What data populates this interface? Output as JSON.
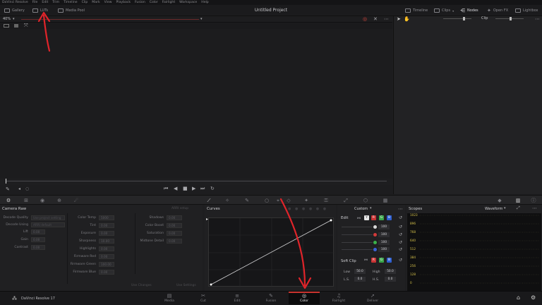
{
  "menu": [
    "DaVinci Resolve",
    "File",
    "Edit",
    "Trim",
    "Timeline",
    "Clip",
    "Mark",
    "View",
    "Playback",
    "Fusion",
    "Color",
    "Fairlight",
    "Workspace",
    "Help"
  ],
  "toolbar": {
    "gallery": "Gallery",
    "luts": "LUTs",
    "media_pool": "Media Pool",
    "project_title": "Untitled Project",
    "timeline": "Timeline",
    "clips": "Clips",
    "nodes": "Nodes",
    "open_fx": "Open FX",
    "lightbox": "Lightbox"
  },
  "viewer": {
    "zoom": "40%",
    "clip_label": "Clip"
  },
  "camera_raw": {
    "title": "Camera Raw",
    "decode_quality_label": "Decode Quality",
    "decode_quality_value": "Use project setting",
    "decode_using_label": "Decode Using",
    "decode_using_value": "ARRI default",
    "left_col": [
      {
        "label": "Lift",
        "value": "0.00"
      },
      {
        "label": "Gain",
        "value": "0.00"
      },
      {
        "label": "Contrast",
        "value": "0.00"
      }
    ],
    "mid_col": [
      {
        "label": "Color Temp",
        "value": "5000"
      },
      {
        "label": "Tint",
        "value": "0.00"
      },
      {
        "label": "Exposure",
        "value": "0.00"
      },
      {
        "label": "Sharpness",
        "value": "10.00"
      },
      {
        "label": "Highlights",
        "value": "0.00"
      },
      {
        "label": "Shadows",
        "value": "0.00"
      },
      {
        "label": "Color Boost",
        "value": "0.00"
      },
      {
        "label": "Saturation",
        "value": "0.00"
      }
    ],
    "right_col": [
      {
        "label": "Shadows",
        "value": "0.00"
      },
      {
        "label": "Color Boost",
        "value": "0.00"
      },
      {
        "label": "Saturation",
        "value": "0.00"
      },
      {
        "label": "Midtone Detail",
        "value": "0.00"
      }
    ],
    "hdr_badge": "ARRI setup",
    "mid_extra": [
      {
        "label": "Firmware Red",
        "value": "0.00"
      },
      {
        "label": "Firmware Green",
        "value": "100.00"
      },
      {
        "label": "Firmware Blue",
        "value": "0.00"
      }
    ],
    "use_changes": "Use Changes",
    "use_settings": "Use Settings"
  },
  "curves": {
    "title": "Curves",
    "mode": "Custom"
  },
  "edit": {
    "title": "Edit",
    "rows": [
      {
        "color": "#d8d8d8",
        "value": "100"
      },
      {
        "color": "#d23a3a",
        "value": "100"
      },
      {
        "color": "#3ab04a",
        "value": "100"
      },
      {
        "color": "#3a62d8",
        "value": "100"
      }
    ],
    "soft_clip_title": "Soft Clip",
    "low_label": "Low",
    "low_value": "50.0",
    "high_label": "High",
    "high_value": "50.0",
    "ls_label": "L.S.",
    "ls_value": "0.0",
    "hs_label": "H.S.",
    "hs_value": "0.0"
  },
  "scopes": {
    "title": "Scopes",
    "mode": "Waveform",
    "scale": [
      "1023",
      "896",
      "768",
      "640",
      "512",
      "384",
      "256",
      "128",
      "0"
    ]
  },
  "bottom": {
    "app_name": "DaVinci Resolve 17",
    "pages": [
      "Media",
      "Cut",
      "Edit",
      "Fusion",
      "Color",
      "Fairlight",
      "Deliver"
    ]
  },
  "accent": "#c8342f"
}
